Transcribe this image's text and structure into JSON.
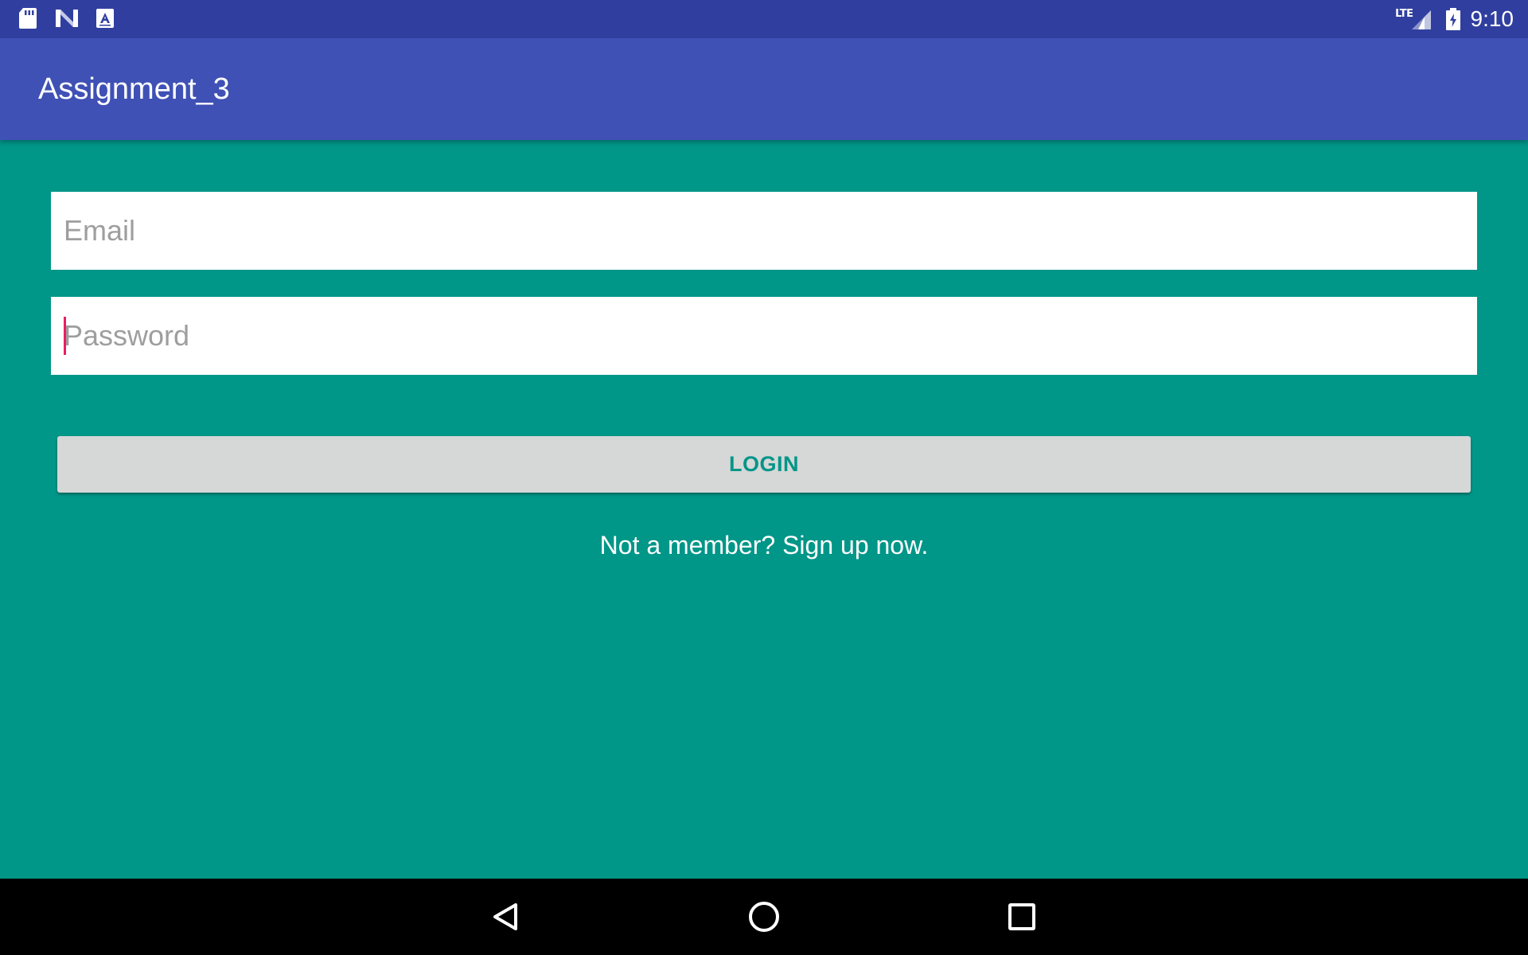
{
  "status_bar": {
    "left_icons": [
      "sd-card-icon",
      "n-notification-icon",
      "a-notification-icon"
    ],
    "network_label": "LTE",
    "time": "9:10"
  },
  "app_bar": {
    "title": "Assignment_3"
  },
  "form": {
    "email_placeholder": "Email",
    "email_value": "",
    "password_placeholder": "Password",
    "password_value": "",
    "login_label": "LOGIN",
    "signup_text": "Not a member? Sign up now."
  },
  "nav_bar": {
    "buttons": [
      "back-icon",
      "home-icon",
      "recents-icon"
    ]
  },
  "colors": {
    "status_bar": "#303F9F",
    "app_bar": "#3F51B5",
    "background": "#009688",
    "button": "#D6D7D7",
    "button_text": "#009688",
    "caret": "#E91E63"
  }
}
